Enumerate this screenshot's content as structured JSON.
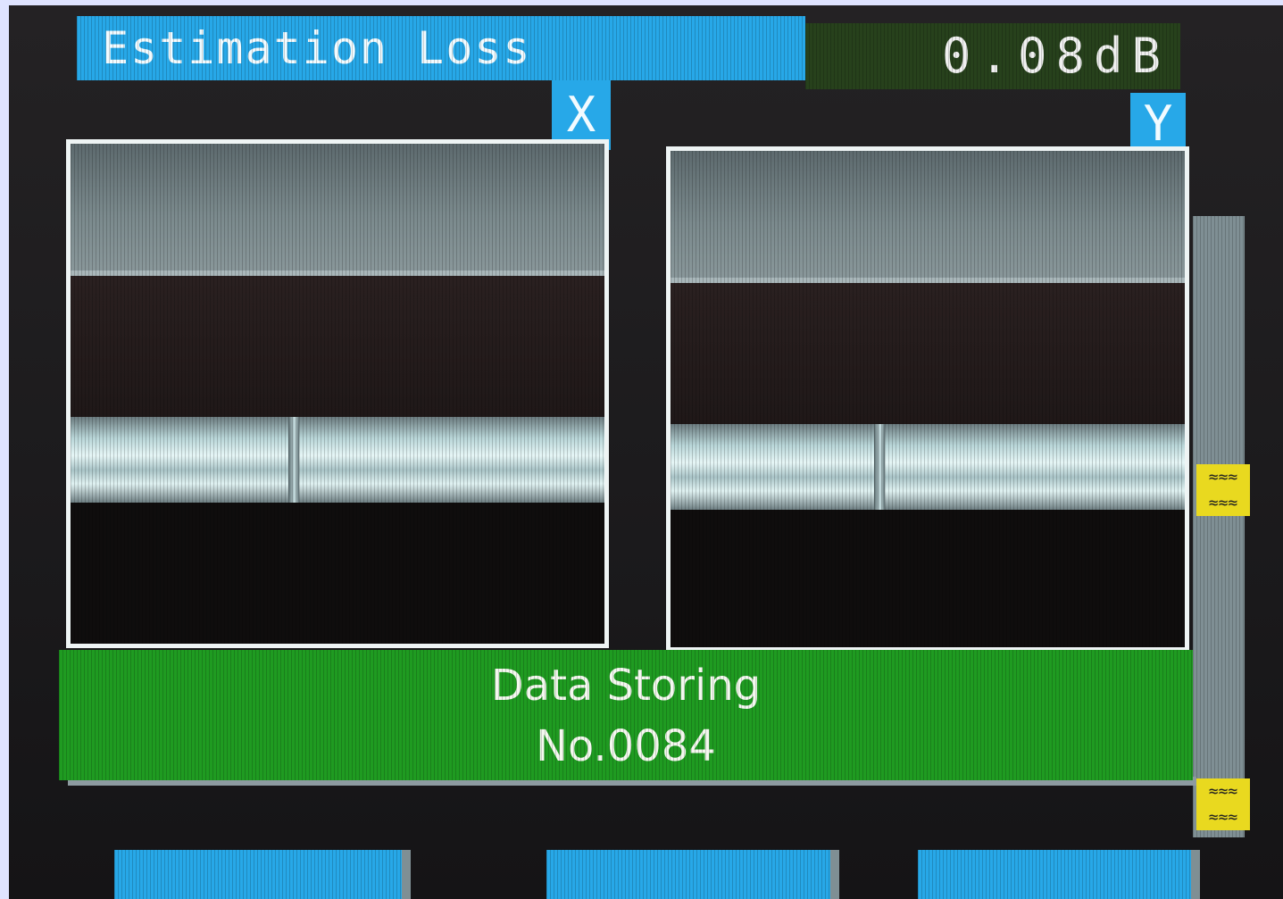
{
  "header": {
    "title": "Estimation Loss",
    "loss_value": "0.08dB"
  },
  "views": {
    "x_label": "X",
    "y_label": "Y"
  },
  "status": {
    "line1": "Data Storing",
    "line2": "No.0084"
  },
  "gauge": {
    "marker_icon": "double-wave-icon"
  },
  "softkeys": [
    {
      "label": ""
    },
    {
      "label": ""
    },
    {
      "label": ""
    }
  ],
  "colors": {
    "accent_blue": "#27a8e8",
    "status_green": "#1f9b21",
    "value_box": "#27411c",
    "marker_yellow": "#e9d91f"
  }
}
